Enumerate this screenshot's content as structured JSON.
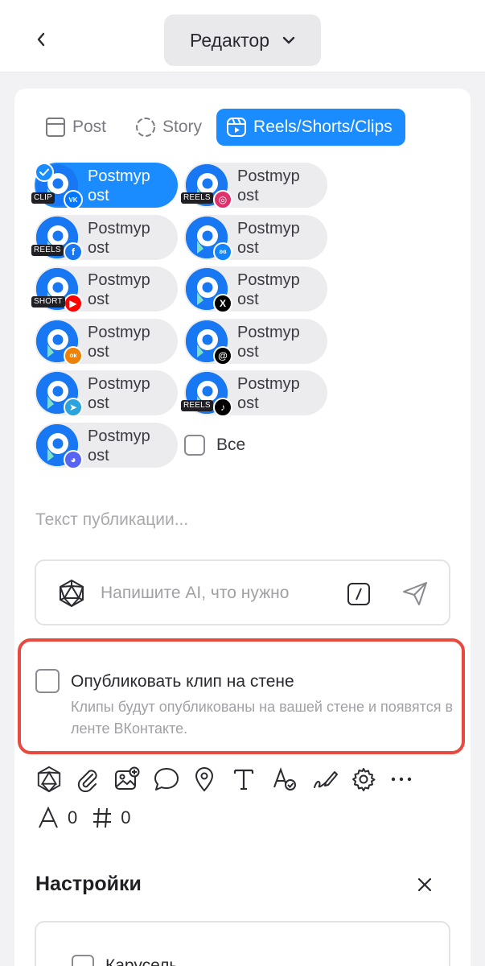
{
  "header": {
    "title": "Редактор"
  },
  "tabs": [
    {
      "label": "Post"
    },
    {
      "label": "Story"
    },
    {
      "label": "Reels/Shorts/Clips"
    }
  ],
  "accounts": [
    {
      "name_line1": "Postmyp",
      "name_line2": "ost",
      "network": "vk-icon",
      "format": "CLIP",
      "selected": true
    },
    {
      "name_line1": "Postmyp",
      "name_line2": "ost",
      "network": "instagram-icon",
      "format": "REELS",
      "selected": false
    },
    {
      "name_line1": "Postmyp",
      "name_line2": "ost",
      "network": "facebook-icon",
      "format": "REELS",
      "selected": false
    },
    {
      "name_line1": "Postmyp",
      "name_line2": "ost",
      "network": "bluesky-icon",
      "format": "",
      "selected": false
    },
    {
      "name_line1": "Postmyp",
      "name_line2": "ost",
      "network": "youtube-icon",
      "format": "SHORT",
      "selected": false
    },
    {
      "name_line1": "Postmyp",
      "name_line2": "ost",
      "network": "x-icon",
      "format": "",
      "selected": false
    },
    {
      "name_line1": "Postmyp",
      "name_line2": "ost",
      "network": "odnoklassniki-icon",
      "format": "",
      "selected": false
    },
    {
      "name_line1": "Postmyp",
      "name_line2": "ost",
      "network": "threads-icon",
      "format": "",
      "selected": false
    },
    {
      "name_line1": "Postmyp",
      "name_line2": "ost",
      "network": "telegram-icon",
      "format": "",
      "selected": false
    },
    {
      "name_line1": "Postmyp",
      "name_line2": "ost",
      "network": "tiktok-icon",
      "format": "REELS",
      "selected": false
    },
    {
      "name_line1": "Postmyp",
      "name_line2": "ost",
      "network": "discord-icon",
      "format": "",
      "selected": false
    }
  ],
  "select_all_label": "Все",
  "post_text_placeholder": "Текст публикации...",
  "ai": {
    "placeholder": "Напишите AI, что нужно"
  },
  "vk_wall": {
    "title": "Опубликовать клип на стене",
    "description": "Клипы будут опубликованы на вашей стене и появятся в ленте ВКонтакте."
  },
  "counters": {
    "chars": "0",
    "hashtags": "0"
  },
  "settings": {
    "title": "Настройки",
    "carousel_label": "Карусель"
  },
  "colors": {
    "accent": "#1a8cff",
    "highlight_border": "#e84a3f"
  }
}
